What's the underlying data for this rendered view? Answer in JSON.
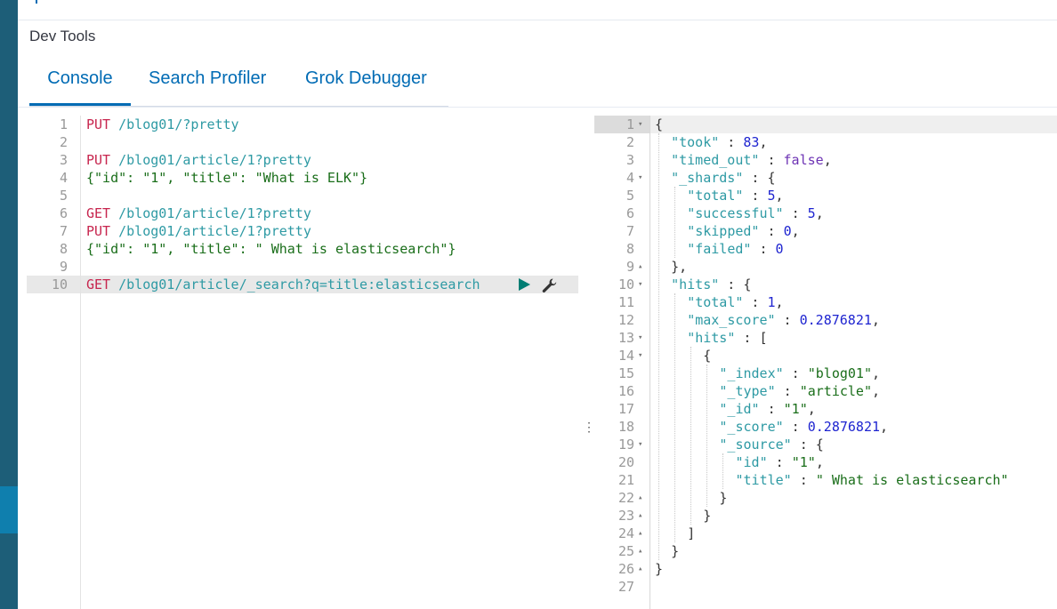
{
  "app": {
    "title": "Dev Tools"
  },
  "tabs": [
    {
      "label": "Console",
      "active": true
    },
    {
      "label": "Search Profiler",
      "active": false
    },
    {
      "label": "Grok Debugger",
      "active": false
    }
  ],
  "colors": {
    "nav": "#1d5e78",
    "accent": "#006bb4",
    "method": "#c7254e",
    "path": "#2e9aa4",
    "string": "#1a6e1a",
    "number": "#1e24d0",
    "boolean": "#6d33b4"
  },
  "icons": {
    "run": "play-icon",
    "settings": "wrench-icon",
    "resize": "vertical-dots-icon"
  },
  "input": {
    "line_numbers": [
      "1",
      "2",
      "3",
      "4",
      "5",
      "6",
      "7",
      "8",
      "9",
      "10"
    ],
    "active_line": 10,
    "lines": [
      {
        "method": "PUT",
        "path": " /blog01/?pretty"
      },
      {},
      {
        "method": "PUT",
        "path": " /blog01/article/1?pretty"
      },
      {
        "body": "{\"id\": \"1\", \"title\": \"What is ELK\"}"
      },
      {},
      {
        "method": "GET",
        "path": " /blog01/article/1?pretty"
      },
      {
        "method": "PUT",
        "path": " /blog01/article/1?pretty"
      },
      {
        "body": "{\"id\": \"1\", \"title\": \" What is elasticsearch\"}"
      },
      {},
      {
        "method": "GET",
        "path": " /blog01/article/_search?q=title:elasticsearch"
      }
    ]
  },
  "output": {
    "line_numbers": [
      "1",
      "2",
      "3",
      "4",
      "5",
      "6",
      "7",
      "8",
      "9",
      "10",
      "11",
      "12",
      "13",
      "14",
      "15",
      "16",
      "17",
      "18",
      "19",
      "20",
      "21",
      "22",
      "23",
      "24",
      "25",
      "26",
      "27"
    ],
    "fold_markers": [
      "▾",
      "",
      "",
      "▾",
      "",
      "",
      "",
      "",
      "▴",
      "▾",
      "",
      "",
      "▾",
      "▾",
      "",
      "",
      "",
      "",
      "▾",
      "",
      "",
      "▴",
      "▴",
      "▴",
      "▴",
      "▴",
      ""
    ],
    "tokens": [
      [
        [
          "p",
          "{"
        ]
      ],
      [
        [
          "k",
          "\"took\""
        ],
        [
          "p",
          " : "
        ],
        [
          "n",
          "83"
        ],
        [
          "p",
          ","
        ]
      ],
      [
        [
          "k",
          "\"timed_out\""
        ],
        [
          "p",
          " : "
        ],
        [
          "b",
          "false"
        ],
        [
          "p",
          ","
        ]
      ],
      [
        [
          "k",
          "\"_shards\""
        ],
        [
          "p",
          " : {"
        ]
      ],
      [
        [
          "k",
          "\"total\""
        ],
        [
          "p",
          " : "
        ],
        [
          "n",
          "5"
        ],
        [
          "p",
          ","
        ]
      ],
      [
        [
          "k",
          "\"successful\""
        ],
        [
          "p",
          " : "
        ],
        [
          "n",
          "5"
        ],
        [
          "p",
          ","
        ]
      ],
      [
        [
          "k",
          "\"skipped\""
        ],
        [
          "p",
          " : "
        ],
        [
          "n",
          "0"
        ],
        [
          "p",
          ","
        ]
      ],
      [
        [
          "k",
          "\"failed\""
        ],
        [
          "p",
          " : "
        ],
        [
          "n",
          "0"
        ]
      ],
      [
        [
          "p",
          "},"
        ]
      ],
      [
        [
          "k",
          "\"hits\""
        ],
        [
          "p",
          " : {"
        ]
      ],
      [
        [
          "k",
          "\"total\""
        ],
        [
          "p",
          " : "
        ],
        [
          "n",
          "1"
        ],
        [
          "p",
          ","
        ]
      ],
      [
        [
          "k",
          "\"max_score\""
        ],
        [
          "p",
          " : "
        ],
        [
          "n",
          "0.2876821"
        ],
        [
          "p",
          ","
        ]
      ],
      [
        [
          "k",
          "\"hits\""
        ],
        [
          "p",
          " : ["
        ]
      ],
      [
        [
          "p",
          "{"
        ]
      ],
      [
        [
          "k",
          "\"_index\""
        ],
        [
          "p",
          " : "
        ],
        [
          "s",
          "\"blog01\""
        ],
        [
          "p",
          ","
        ]
      ],
      [
        [
          "k",
          "\"_type\""
        ],
        [
          "p",
          " : "
        ],
        [
          "s",
          "\"article\""
        ],
        [
          "p",
          ","
        ]
      ],
      [
        [
          "k",
          "\"_id\""
        ],
        [
          "p",
          " : "
        ],
        [
          "s",
          "\"1\""
        ],
        [
          "p",
          ","
        ]
      ],
      [
        [
          "k",
          "\"_score\""
        ],
        [
          "p",
          " : "
        ],
        [
          "n",
          "0.2876821"
        ],
        [
          "p",
          ","
        ]
      ],
      [
        [
          "k",
          "\"_source\""
        ],
        [
          "p",
          " : {"
        ]
      ],
      [
        [
          "k",
          "\"id\""
        ],
        [
          "p",
          " : "
        ],
        [
          "s",
          "\"1\""
        ],
        [
          "p",
          ","
        ]
      ],
      [
        [
          "k",
          "\"title\""
        ],
        [
          "p",
          " : "
        ],
        [
          "s",
          "\" What is elasticsearch\""
        ]
      ],
      [
        [
          "p",
          "}"
        ]
      ],
      [
        [
          "p",
          "}"
        ]
      ],
      [
        [
          "p",
          "]"
        ]
      ],
      [
        [
          "p",
          "}"
        ]
      ],
      [
        [
          "p",
          "}"
        ]
      ],
      []
    ]
  }
}
